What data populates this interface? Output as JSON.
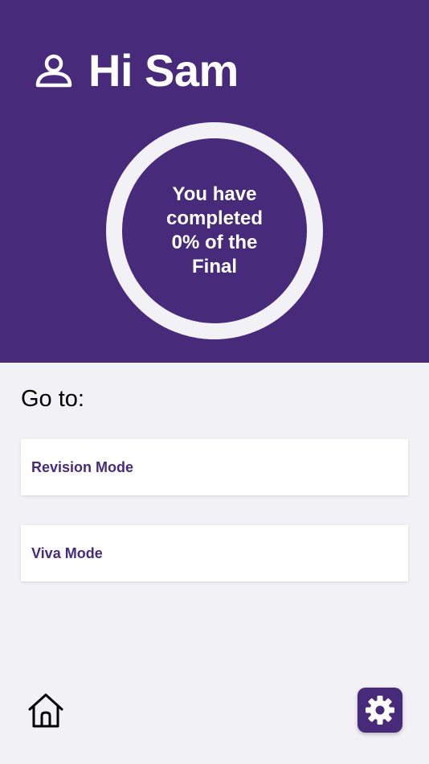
{
  "header": {
    "greeting": "Hi Sam",
    "user_icon": "user-icon"
  },
  "progress": {
    "percent": 0,
    "line1": "You have",
    "line2": "completed",
    "line3": "0% of the",
    "line4": "Final"
  },
  "goto": {
    "title": "Go to:",
    "items": [
      {
        "label": "Revision Mode"
      },
      {
        "label": "Viva Mode"
      }
    ]
  },
  "bottom_bar": {
    "home_icon": "home-icon",
    "settings_icon": "gear-icon"
  },
  "colors": {
    "brand_purple": "#472a7a",
    "background": "#f2f1f6",
    "ring": "#f2f1f6",
    "card": "#ffffff"
  }
}
